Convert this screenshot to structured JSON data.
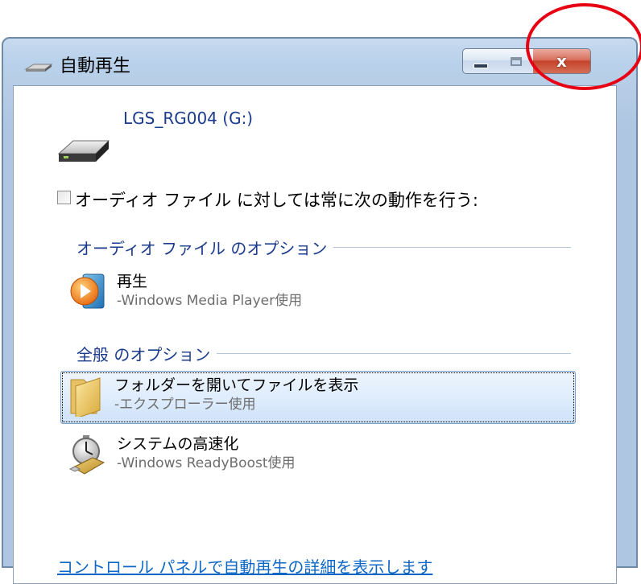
{
  "window": {
    "title": "自動再生"
  },
  "titlebar": {
    "minimize_icon": "minimize-icon",
    "maximize_icon": "maximize-icon",
    "close_symbol": "x"
  },
  "drive": {
    "label": "LGS_RG004 (G:)",
    "icon": "drive-icon"
  },
  "always_checkbox": {
    "label": "オーディオ ファイル に対しては常に次の動作を行う:",
    "checked": false
  },
  "sections": {
    "audio_header": "オーディオ ファイル のオプション",
    "general_header": "全般 のオプション"
  },
  "options": {
    "play": {
      "title": "再生",
      "subtitle": "-Windows Media Player使用",
      "icon": "media-player-icon"
    },
    "open_folder": {
      "title": "フォルダーを開いてファイルを表示",
      "subtitle": "-エクスプローラー使用",
      "icon": "folder-icon"
    },
    "speed_up": {
      "title": "システムの高速化",
      "subtitle": "-Windows ReadyBoost使用",
      "icon": "readyboost-icon"
    }
  },
  "footer": {
    "link": "コントロール パネルで自動再生の詳細を表示します"
  },
  "colors": {
    "accent_text": "#1c3b8d",
    "link": "#0b66c4",
    "annotation": "#e60012",
    "close_button": "#c4432a"
  }
}
